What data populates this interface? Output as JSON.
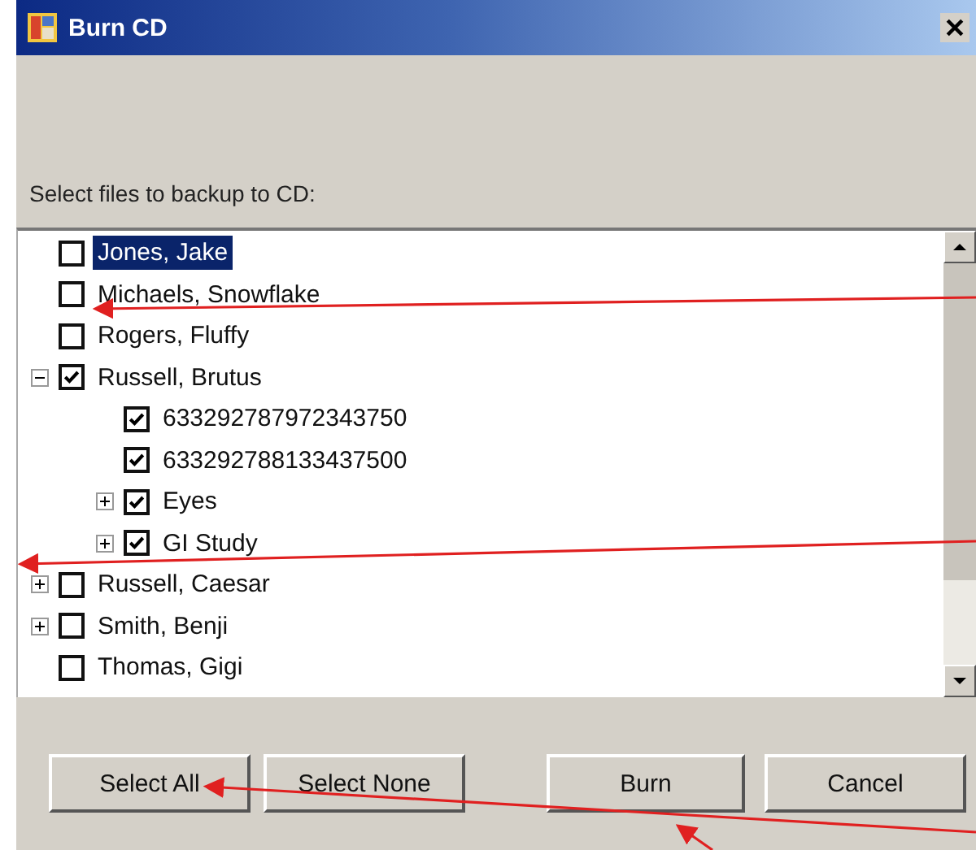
{
  "window": {
    "title": "Burn CD"
  },
  "prompt": "Select files to backup to CD:",
  "tree": [
    {
      "label": "Jones, Jake",
      "checked": false,
      "selected": true
    },
    {
      "label": "Michaels, Snowflake",
      "checked": false,
      "selected": false
    },
    {
      "label": "Rogers, Fluffy",
      "checked": false,
      "selected": false
    },
    {
      "label": "Russell, Brutus",
      "checked": true,
      "selected": false,
      "expanded": true,
      "children": [
        {
          "label": "633292787972343750",
          "checked": true,
          "selected": false
        },
        {
          "label": "633292788133437500",
          "checked": true,
          "selected": false
        },
        {
          "label": "Eyes",
          "checked": true,
          "selected": false,
          "expanded": false
        },
        {
          "label": "GI Study",
          "checked": true,
          "selected": false,
          "expanded": false
        }
      ]
    },
    {
      "label": "Russell, Caesar",
      "checked": false,
      "selected": false,
      "expanded": false
    },
    {
      "label": "Smith, Benji",
      "checked": false,
      "selected": false,
      "expanded": false
    },
    {
      "label": "Thomas, Gigi",
      "checked": false,
      "selected": false
    }
  ],
  "buttons": [
    "Select All",
    "Select None",
    "Burn",
    "Cancel"
  ]
}
